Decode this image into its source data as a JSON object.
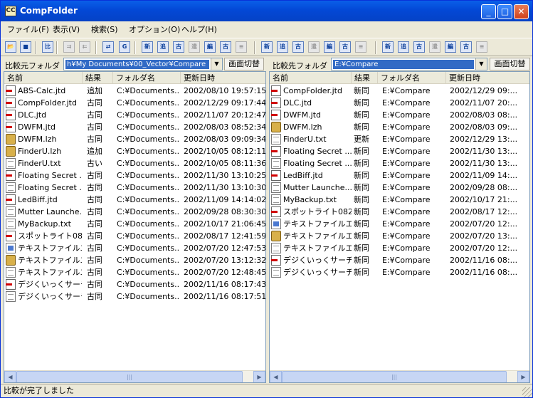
{
  "window": {
    "title": "CompFolder",
    "app_icon_glyph": "CC"
  },
  "titlebar_buttons": {
    "minimize": "_",
    "maximize": "□",
    "close": "✕"
  },
  "menu": [
    "ファイル(F)",
    "表示(V)",
    "検索(S)",
    "オプション(O)",
    "ヘルプ(H)"
  ],
  "toolbar": {
    "buttons": [
      {
        "name": "open-folder",
        "glyph": "📂",
        "enabled": true
      },
      {
        "name": "save",
        "glyph": "■",
        "enabled": true
      },
      {
        "name": "compare",
        "glyph": "比",
        "enabled": true
      },
      {
        "name": "copy-right",
        "glyph": "⇉",
        "enabled": false
      },
      {
        "name": "copy-left",
        "glyph": "⇇",
        "enabled": false
      },
      {
        "name": "sync",
        "glyph": "⇄",
        "enabled": true
      },
      {
        "name": "goto",
        "glyph": "G",
        "enabled": true
      },
      {
        "name": "new",
        "glyph": "新",
        "enabled": true
      },
      {
        "name": "added",
        "glyph": "追",
        "enabled": true
      },
      {
        "name": "old",
        "glyph": "古",
        "enabled": true
      },
      {
        "name": "deleted",
        "glyph": "遣",
        "enabled": false
      },
      {
        "name": "edit",
        "glyph": "編",
        "enabled": true
      },
      {
        "name": "same-old",
        "glyph": "古",
        "enabled": true
      },
      {
        "name": "equal",
        "glyph": "≡",
        "enabled": false
      },
      {
        "name": "sort-new",
        "glyph": "新",
        "enabled": true
      },
      {
        "name": "sort-added",
        "glyph": "追",
        "enabled": true
      },
      {
        "name": "sort-old",
        "glyph": "古",
        "enabled": true
      },
      {
        "name": "sort-deleted",
        "glyph": "遣",
        "enabled": false
      },
      {
        "name": "sort-edit",
        "glyph": "編",
        "enabled": true
      },
      {
        "name": "sort-same",
        "glyph": "古",
        "enabled": true
      },
      {
        "name": "sort-equal",
        "glyph": "≡",
        "enabled": false
      },
      {
        "name": "filter-new",
        "glyph": "新",
        "enabled": true
      },
      {
        "name": "filter-added",
        "glyph": "追",
        "enabled": true
      },
      {
        "name": "filter-old",
        "glyph": "古",
        "enabled": true
      },
      {
        "name": "filter-deleted",
        "glyph": "遣",
        "enabled": false
      },
      {
        "name": "filter-edit",
        "glyph": "編",
        "enabled": true
      },
      {
        "name": "filter-same",
        "glyph": "古",
        "enabled": true
      },
      {
        "name": "filter-equal",
        "glyph": "≡",
        "enabled": false
      }
    ]
  },
  "left": {
    "label": "比較元フォルダ",
    "path": "h¥My Documents¥00_Vector¥Compare",
    "switch_button": "画面切替",
    "columns": [
      "名前",
      "結果",
      "フォルダ名",
      "更新日時"
    ],
    "rows": [
      {
        "icon": "jtd",
        "name": "ABS-Calc.jtd",
        "result": "追加",
        "folder": "C:¥Documents...",
        "date": "2002/08/10 19:57:15"
      },
      {
        "icon": "jtd",
        "name": "CompFolder.jtd",
        "result": "古同",
        "folder": "C:¥Documents...",
        "date": "2002/12/29 09:17:44"
      },
      {
        "icon": "jtd",
        "name": "DLC.jtd",
        "result": "古同",
        "folder": "C:¥Documents...",
        "date": "2002/11/07 20:12:47"
      },
      {
        "icon": "jtd",
        "name": "DWFM.jtd",
        "result": "古同",
        "folder": "C:¥Documents...",
        "date": "2002/08/03 08:52:34"
      },
      {
        "icon": "lzh",
        "name": "DWFM.lzh",
        "result": "古同",
        "folder": "C:¥Documents...",
        "date": "2002/08/03 09:09:34"
      },
      {
        "icon": "lzh",
        "name": "FinderU.lzh",
        "result": "追加",
        "folder": "C:¥Documents...",
        "date": "2002/10/05 08:12:11"
      },
      {
        "icon": "txt",
        "name": "FinderU.txt",
        "result": "古い",
        "folder": "C:¥Documents...",
        "date": "2002/10/05 08:11:36"
      },
      {
        "icon": "jtd",
        "name": "Floating Secret ...",
        "result": "古同",
        "folder": "C:¥Documents...",
        "date": "2002/11/30 13:10:25"
      },
      {
        "icon": "txt",
        "name": "Floating Secret ...",
        "result": "古同",
        "folder": "C:¥Documents...",
        "date": "2002/11/30 13:10:30"
      },
      {
        "icon": "jtd",
        "name": "LedBiff.jtd",
        "result": "古同",
        "folder": "C:¥Documents...",
        "date": "2002/11/09 14:14:02"
      },
      {
        "icon": "txt",
        "name": "Mutter Launche...",
        "result": "古同",
        "folder": "C:¥Documents...",
        "date": "2002/09/28 08:30:30"
      },
      {
        "icon": "txt",
        "name": "MyBackup.txt",
        "result": "古同",
        "folder": "C:¥Documents...",
        "date": "2002/10/17 21:06:45"
      },
      {
        "icon": "jtd",
        "name": "スポットライト082...",
        "result": "古同",
        "folder": "C:¥Documents...",
        "date": "2002/08/17 12:41:59"
      },
      {
        "icon": "exe",
        "name": "テキストファイルエ...",
        "result": "古同",
        "folder": "C:¥Documents...",
        "date": "2002/07/20 12:47:53"
      },
      {
        "icon": "lzh",
        "name": "テキストファイルエ...",
        "result": "古同",
        "folder": "C:¥Documents...",
        "date": "2002/07/20 13:12:32"
      },
      {
        "icon": "txt",
        "name": "テキストファイルエ...",
        "result": "古同",
        "folder": "C:¥Documents...",
        "date": "2002/07/20 12:48:45"
      },
      {
        "icon": "jtd",
        "name": "デジくいっくサーチ...",
        "result": "古同",
        "folder": "C:¥Documents...",
        "date": "2002/11/16 08:17:43"
      },
      {
        "icon": "txt",
        "name": "デジくいっくサーチ...",
        "result": "古同",
        "folder": "C:¥Documents...",
        "date": "2002/11/16 08:17:51"
      }
    ]
  },
  "right": {
    "label": "比較先フォルダ",
    "path": "E:¥Compare",
    "switch_button": "画面切替",
    "columns": [
      "名前",
      "結果",
      "フォルダ名",
      "更新日時"
    ],
    "rows": [
      {
        "icon": "jtd",
        "name": "CompFolder.jtd",
        "result": "新同",
        "folder": "E:¥Compare",
        "date": "2002/12/29 09:..."
      },
      {
        "icon": "jtd",
        "name": "DLC.jtd",
        "result": "新同",
        "folder": "E:¥Compare",
        "date": "2002/11/07 20:..."
      },
      {
        "icon": "jtd",
        "name": "DWFM.jtd",
        "result": "新同",
        "folder": "E:¥Compare",
        "date": "2002/08/03 08:..."
      },
      {
        "icon": "lzh",
        "name": "DWFM.lzh",
        "result": "新同",
        "folder": "E:¥Compare",
        "date": "2002/08/03 09:..."
      },
      {
        "icon": "txt",
        "name": "FinderU.txt",
        "result": "更新",
        "folder": "E:¥Compare",
        "date": "2002/12/29 13:..."
      },
      {
        "icon": "jtd",
        "name": "Floating Secret ...",
        "result": "新同",
        "folder": "E:¥Compare",
        "date": "2002/11/30 13:..."
      },
      {
        "icon": "txt",
        "name": "Floating Secret ...",
        "result": "新同",
        "folder": "E:¥Compare",
        "date": "2002/11/30 13:..."
      },
      {
        "icon": "jtd",
        "name": "LedBiff.jtd",
        "result": "新同",
        "folder": "E:¥Compare",
        "date": "2002/11/09 14:..."
      },
      {
        "icon": "txt",
        "name": "Mutter Launche...",
        "result": "新同",
        "folder": "E:¥Compare",
        "date": "2002/09/28 08:..."
      },
      {
        "icon": "txt",
        "name": "MyBackup.txt",
        "result": "新同",
        "folder": "E:¥Compare",
        "date": "2002/10/17 21:..."
      },
      {
        "icon": "jtd",
        "name": "スポットライト082...",
        "result": "新同",
        "folder": "E:¥Compare",
        "date": "2002/08/17 12:..."
      },
      {
        "icon": "exe",
        "name": "テキストファイルエ...",
        "result": "新同",
        "folder": "E:¥Compare",
        "date": "2002/07/20 12:..."
      },
      {
        "icon": "lzh",
        "name": "テキストファイルエ...",
        "result": "新同",
        "folder": "E:¥Compare",
        "date": "2002/07/20 13:..."
      },
      {
        "icon": "txt",
        "name": "テキストファイルエ...",
        "result": "新同",
        "folder": "E:¥Compare",
        "date": "2002/07/20 12:..."
      },
      {
        "icon": "jtd",
        "name": "デジくいっくサーチ...",
        "result": "新同",
        "folder": "E:¥Compare",
        "date": "2002/11/16 08:..."
      },
      {
        "icon": "txt",
        "name": "デジくいっくサーチ...",
        "result": "新同",
        "folder": "E:¥Compare",
        "date": "2002/11/16 08:..."
      }
    ]
  },
  "status": "比較が完了しました"
}
